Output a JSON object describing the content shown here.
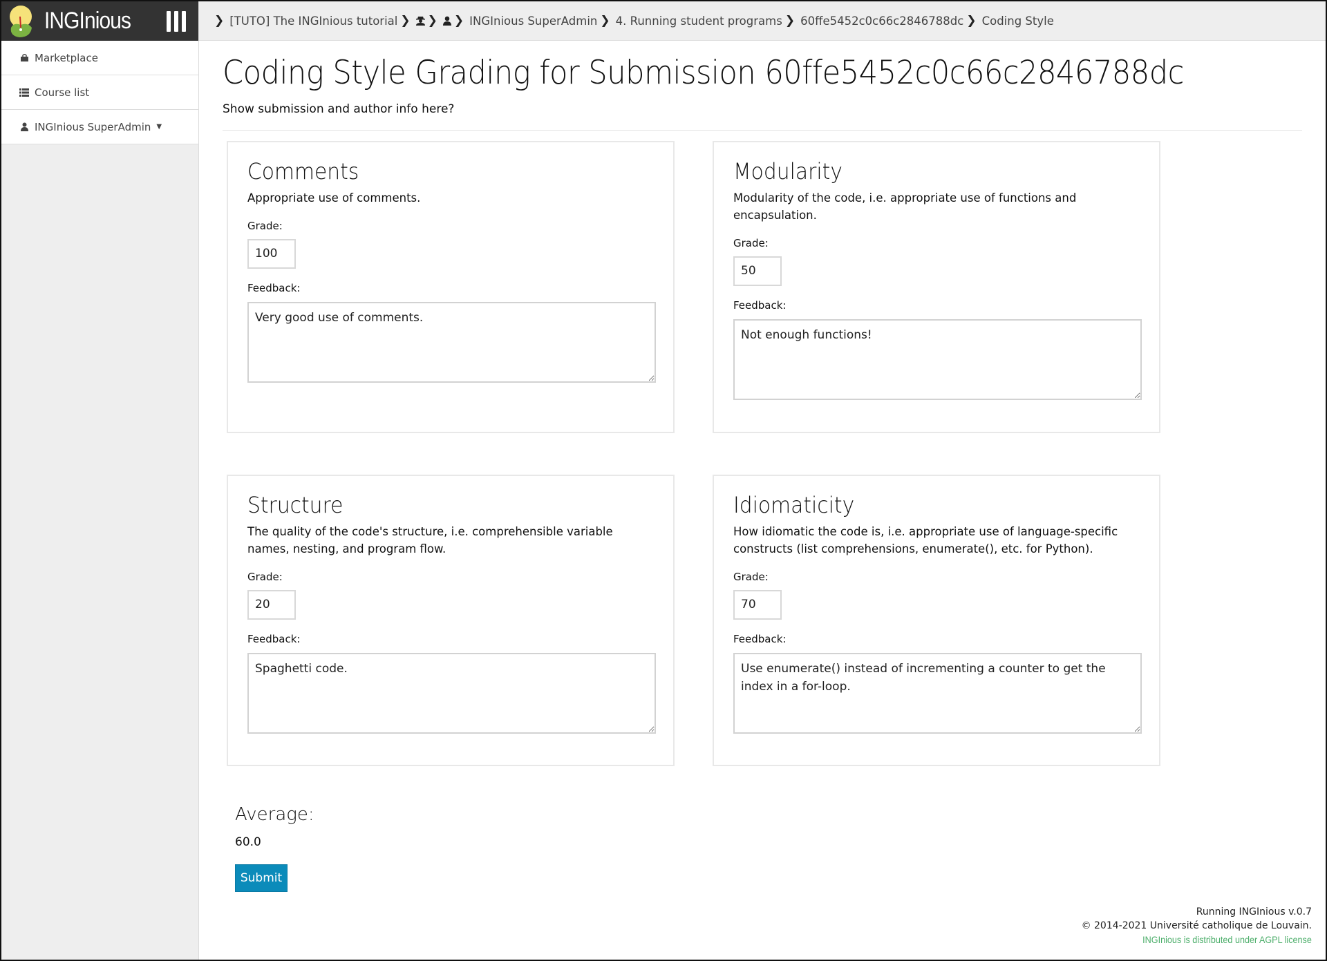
{
  "app": {
    "brand": "INGInious"
  },
  "sidebar": {
    "items": [
      {
        "label": "Marketplace",
        "icon": "shopping-bag-icon"
      },
      {
        "label": "Course list",
        "icon": "list-icon"
      },
      {
        "label": "INGInious SuperAdmin",
        "icon": "user-icon",
        "has_dropdown": true
      }
    ]
  },
  "breadcrumb": {
    "items": [
      {
        "label": "[TUTO] The INGInious tutorial"
      },
      {
        "label": "",
        "icon": "user-secret-icon",
        "glyph": "🕵"
      },
      {
        "label": "",
        "icon": "user-icon",
        "glyph": "👤"
      },
      {
        "label": "INGInious SuperAdmin"
      },
      {
        "label": "4. Running student programs"
      },
      {
        "label": "60ffe5452c0c66c2846788dc"
      },
      {
        "label": "Coding Style"
      }
    ]
  },
  "page": {
    "title": "Coding Style Grading for Submission 60ffe5452c0c66c2846788dc",
    "subtitle": "Show submission and author info here?"
  },
  "criteria": [
    {
      "title": "Comments",
      "description": "Appropriate use of comments.",
      "grade_label": "Grade:",
      "grade": "100",
      "feedback_label": "Feedback:",
      "feedback": "Very good use of comments."
    },
    {
      "title": "Modularity",
      "description": "Modularity of the code, i.e. appropriate use of functions and encapsulation.",
      "grade_label": "Grade:",
      "grade": "50",
      "feedback_label": "Feedback:",
      "feedback": "Not enough functions!"
    },
    {
      "title": "Structure",
      "description": "The quality of the code's structure, i.e. comprehensible variable names, nesting, and program flow.",
      "grade_label": "Grade:",
      "grade": "20",
      "feedback_label": "Feedback:",
      "feedback": "Spaghetti code."
    },
    {
      "title": "Idiomaticity",
      "description": "How idiomatic the code is, i.e. appropriate use of language-specific constructs (list comprehensions, enumerate(), etc. for Python).",
      "grade_label": "Grade:",
      "grade": "70",
      "feedback_label": "Feedback:",
      "feedback": "Use enumerate() instead of incrementing a counter to get the index in a for-loop."
    }
  ],
  "summary": {
    "average_label": "Average:",
    "average_value": "60.0",
    "submit_label": "Submit"
  },
  "footer": {
    "version": "Running INGInious v.0.7",
    "copyright": "© 2014-2021 Université catholique de Louvain.",
    "license": "INGInious is distributed under AGPL license"
  },
  "colors": {
    "header_bg": "#333333",
    "accent": "#0b8bba",
    "license_green": "#4cae6a"
  }
}
